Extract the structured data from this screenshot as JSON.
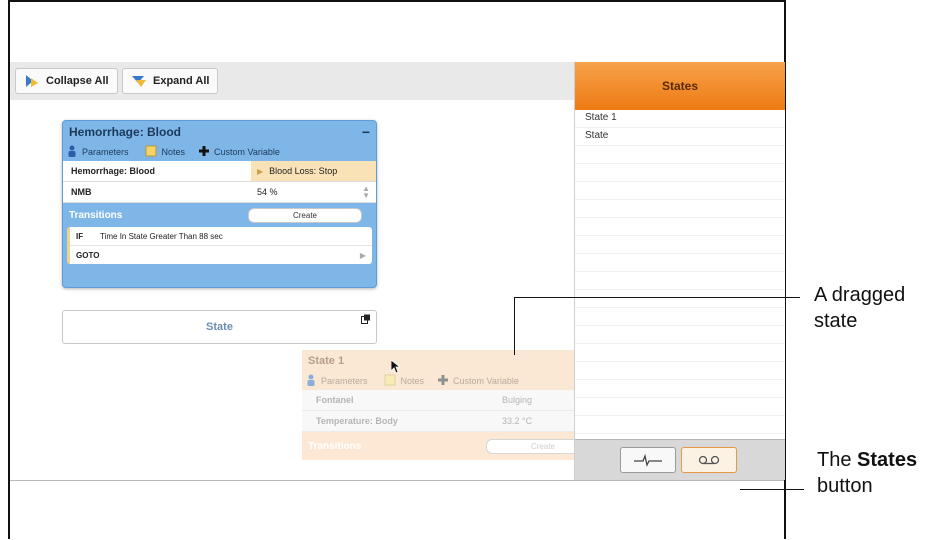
{
  "toolbar": {
    "collapse_label": "Collapse All",
    "expand_label": "Expand All"
  },
  "states_panel": {
    "title": "States",
    "items": [
      "State 1",
      "State"
    ]
  },
  "card": {
    "title": "Hemorrhage: Blood",
    "collapse_symbol": "−",
    "tabs": {
      "parameters": "Parameters",
      "notes": "Notes",
      "custom": "Custom Variable"
    },
    "rows": [
      {
        "name": "Hemorrhage: Blood",
        "value": "Blood Loss: Stop"
      },
      {
        "name": "NMB",
        "value": "54 %"
      }
    ],
    "transitions_label": "Transitions",
    "create_label": "Create",
    "if_label": "IF",
    "condition": "Time In State Greater Than 88 sec",
    "goto_label": "GOTO"
  },
  "state_box": {
    "label": "State"
  },
  "dragged": {
    "title": "State 1",
    "collapse_symbol": "−",
    "tabs": {
      "parameters": "Parameters",
      "notes": "Notes",
      "custom": "Custom Variable"
    },
    "rows": [
      {
        "name": "Fontanel",
        "value": "Bulging"
      },
      {
        "name": "Temperature: Body",
        "value": "33.2 °C"
      }
    ],
    "transitions_label": "Transitions",
    "create_label": "Create"
  },
  "callouts": {
    "dragged_line1": "A dragged",
    "dragged_line2": "state",
    "states_prefix": "The ",
    "states_bold": "States",
    "states_line2": "button"
  },
  "colors": {
    "accent_orange": "#ee7a14",
    "card_blue": "#7fb6e8"
  }
}
